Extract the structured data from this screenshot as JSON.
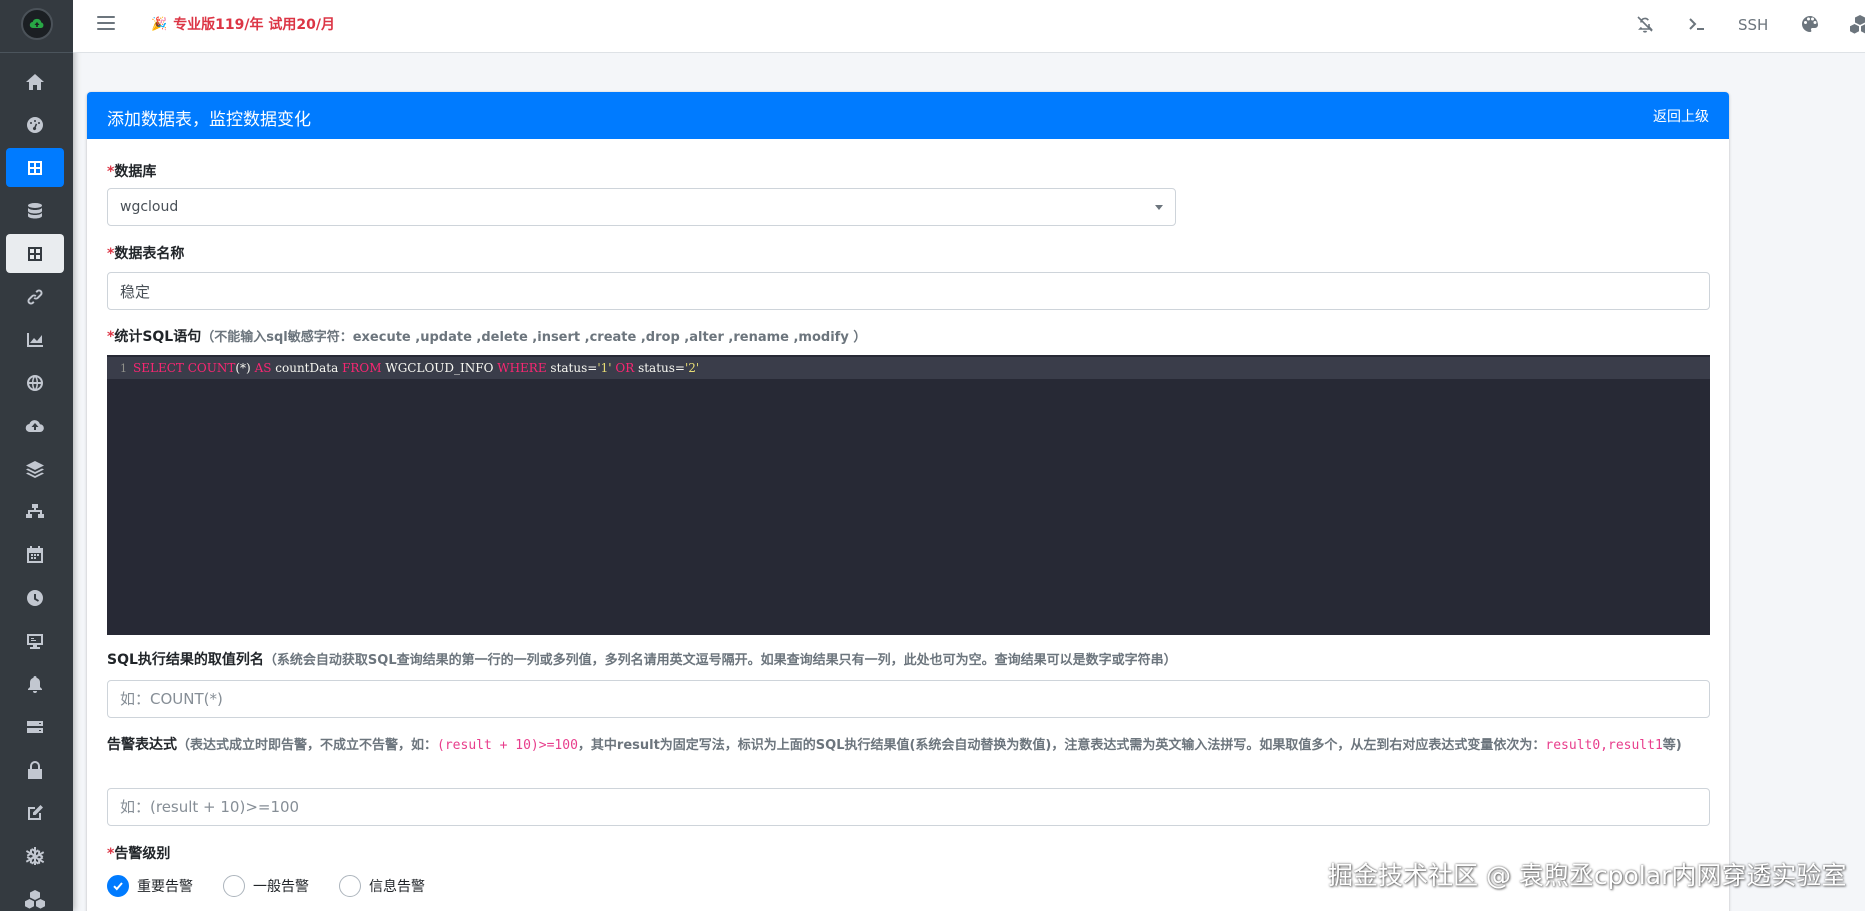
{
  "topbar": {
    "promo": "专业版119/年 试用20/月",
    "ssh_label": "SSH"
  },
  "card": {
    "title": "添加数据表，监控数据变化",
    "back_label": "返回上级"
  },
  "form": {
    "database": {
      "required_mark": "*",
      "label": "数据库",
      "value": "wgcloud"
    },
    "table_name": {
      "required_mark": "*",
      "label": "数据表名称",
      "value": "稳定"
    },
    "sql": {
      "required_mark": "*",
      "label": "统计SQL语句",
      "hint": "（不能输入sql敏感字符：execute ,update ,delete ,insert ,create ,drop ,alter ,rename ,modify ）",
      "line_number": "1",
      "code": "SELECT COUNT(*) AS countData FROM WGCLOUD_INFO WHERE status='1' OR status='2'"
    },
    "result_column": {
      "label": "SQL执行结果的取值列名",
      "hint": "（系统会自动获取SQL查询结果的第一行的一列或多列值，多列名请用英文逗号隔开。如果查询结果只有一列，此处也可为空。查询结果可以是数字或字符串）",
      "placeholder": "如：COUNT(*)"
    },
    "alarm_expr": {
      "label": "告警表达式",
      "hint_a": "（表达式成立时即告警，不成立不告警，如：",
      "code_example": "(result + 10)>=100",
      "hint_b": "，其中result为固定写法，标识为上面的SQL执行结果值(系统会自动替换为数值)，注意表达式需为英文输入法拼写。如果取值多个，从左到右对应表达式变量依次为：",
      "code_vars": "result0,result1",
      "hint_c": "等)",
      "placeholder": "如：(result + 10)>=100"
    },
    "alarm_level": {
      "required_mark": "*",
      "label": "告警级别",
      "options": [
        "重要告警",
        "一般告警",
        "信息告警"
      ],
      "selected": "重要告警"
    }
  },
  "watermark": "掘金技术社区 @ 袁煦丞cpolar内网穿透实验室",
  "colors": {
    "primary": "#007bff",
    "sidebar": "#343a40",
    "danger": "#dc3545",
    "editor_bg": "#272935"
  }
}
